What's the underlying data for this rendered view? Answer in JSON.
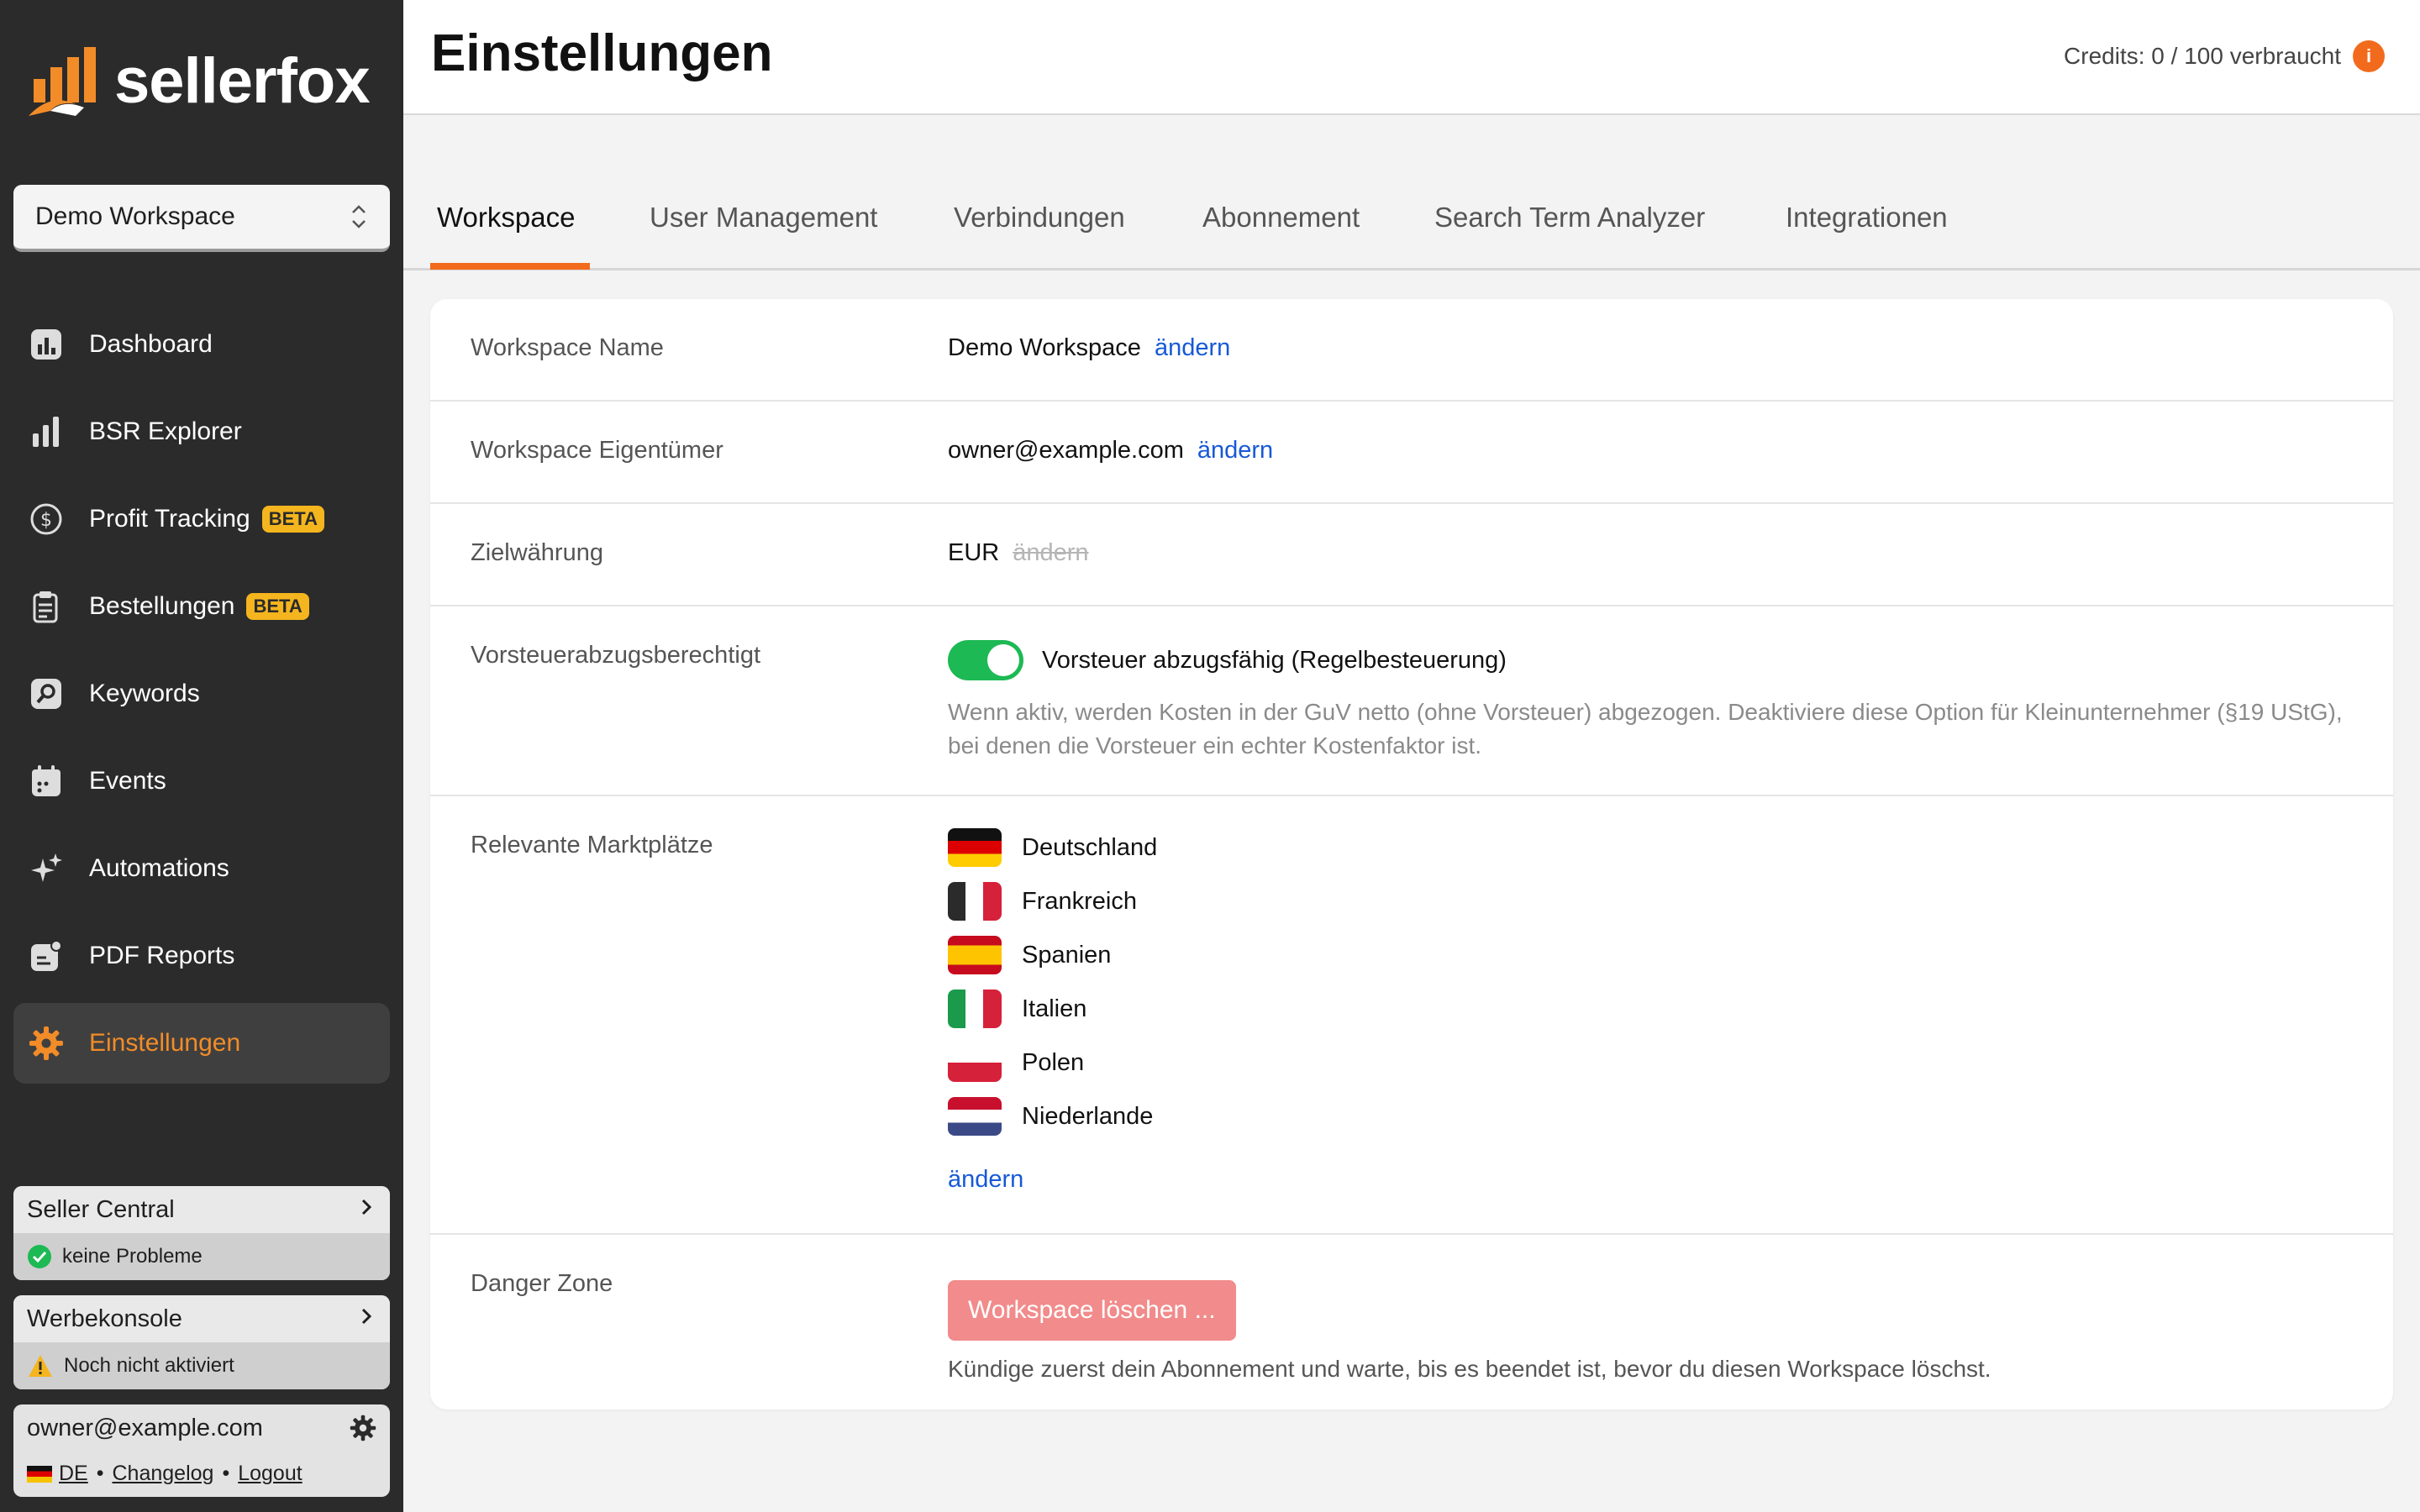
{
  "app": {
    "brand": "sellerfox",
    "workspace_selector": "Demo Workspace"
  },
  "sidebar": {
    "items": [
      {
        "label": "Dashboard",
        "icon": "dashboard-icon",
        "badge": ""
      },
      {
        "label": "BSR Explorer",
        "icon": "bar-chart-icon",
        "badge": ""
      },
      {
        "label": "Profit Tracking",
        "icon": "dollar-circle-icon",
        "badge": "BETA"
      },
      {
        "label": "Bestellungen",
        "icon": "clipboard-icon",
        "badge": "BETA"
      },
      {
        "label": "Keywords",
        "icon": "key-icon",
        "badge": ""
      },
      {
        "label": "Events",
        "icon": "calendar-icon",
        "badge": ""
      },
      {
        "label": "Automations",
        "icon": "sparkles-icon",
        "badge": ""
      },
      {
        "label": "PDF Reports",
        "icon": "report-icon",
        "badge": ""
      },
      {
        "label": "Einstellungen",
        "icon": "gear-icon",
        "badge": "",
        "active": true
      }
    ],
    "seller_central": {
      "title": "Seller Central",
      "status": "keine Probleme",
      "status_icon": "check-circle-icon",
      "status_color": "#1db954"
    },
    "werbekonsole": {
      "title": "Werbekonsole",
      "status": "Noch nicht aktiviert",
      "status_icon": "warning-icon",
      "status_color": "#f5b51e"
    },
    "user": {
      "email": "owner@example.com",
      "lang": "DE",
      "changelog": "Changelog",
      "logout": "Logout",
      "separator": "•"
    }
  },
  "header": {
    "title": "Einstellungen",
    "credits": "Credits: 0 / 100 verbraucht",
    "info_glyph": "i"
  },
  "tabs": [
    "Workspace",
    "User Management",
    "Verbindungen",
    "Abonnement",
    "Search Term Analyzer",
    "Integrationen"
  ],
  "settings": {
    "workspace_name": {
      "label": "Workspace Name",
      "value": "Demo Workspace",
      "action": "ändern"
    },
    "owner": {
      "label": "Workspace Eigentümer",
      "value": "owner@example.com",
      "action": "ändern"
    },
    "currency": {
      "label": "Zielwährung",
      "value": "EUR",
      "action": "ändern"
    },
    "vat": {
      "label": "Vorsteuerabzugsberechtigt",
      "toggle_on": true,
      "toggle_label": "Vorsteuer abzugsfähig (Regelbesteuerung)",
      "hint": "Wenn aktiv, werden Kosten in der GuV netto (ohne Vorsteuer) abgezogen. Deaktiviere diese Option für Kleinunternehmer (§19 UStG), bei denen die Vorsteuer ein echter Kostenfaktor ist."
    },
    "marketplaces": {
      "label": "Relevante Marktplätze",
      "items": [
        "Deutschland",
        "Frankreich",
        "Spanien",
        "Italien",
        "Polen",
        "Niederlande"
      ],
      "action": "ändern"
    },
    "danger": {
      "label": "Danger Zone",
      "button": "Workspace löschen ...",
      "hint": "Kündige zuerst dein Abonnement und warte, bis es beendet ist, bevor du diesen Workspace löschst."
    }
  },
  "colors": {
    "accent": "#f26b1d",
    "link": "#1759d6",
    "sidebar_bg": "#2b2b2b",
    "toggle": "#1db954",
    "danger": "#f28b8b"
  }
}
